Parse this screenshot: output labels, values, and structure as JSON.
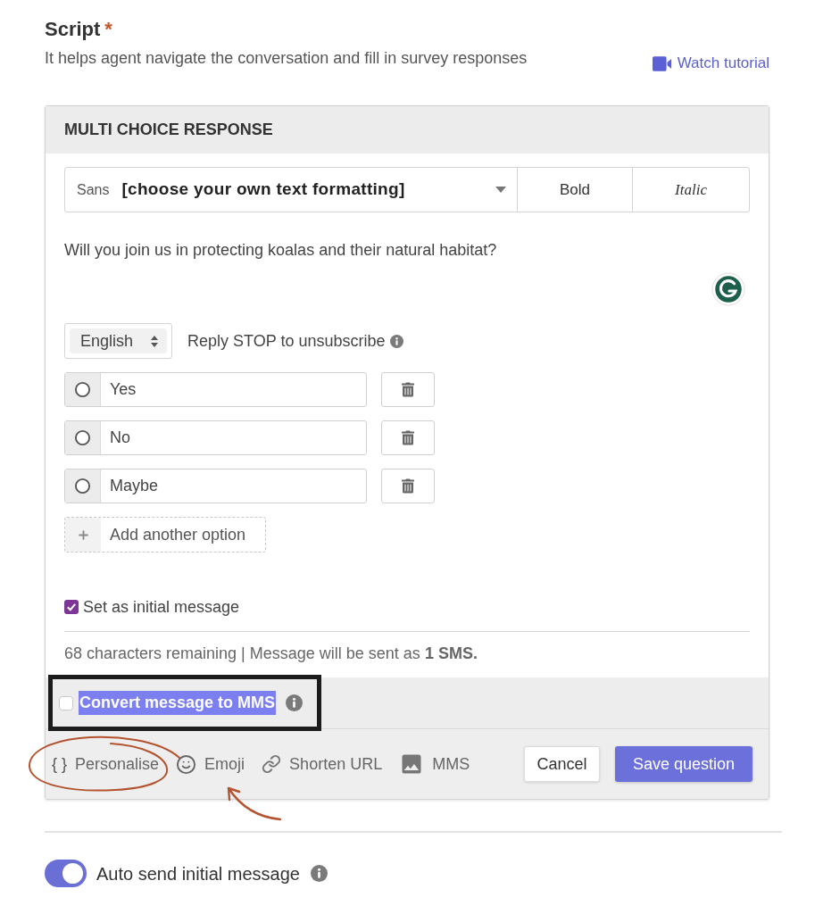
{
  "header": {
    "title": "Script",
    "required_mark": "*",
    "subtitle": "It helps agent navigate the conversation and fill in survey responses",
    "tutorial_link": "Watch tutorial"
  },
  "card": {
    "title": "MULTI CHOICE RESPONSE",
    "format_bar": {
      "font": "Sans",
      "style": "[choose your own text formatting]",
      "buttons": [
        {
          "label": "Bold",
          "kind": "bold"
        },
        {
          "label": "Italic",
          "kind": "italic"
        }
      ]
    },
    "message": "Will you join us in protecting koalas and their natural habitat?",
    "language": "English",
    "opt_out": "Reply STOP to unsubscribe",
    "options": [
      {
        "label": "Yes",
        "selected": false
      },
      {
        "label": "No",
        "selected": false
      },
      {
        "label": "Maybe",
        "selected": false
      }
    ],
    "add_option": "Add another option",
    "initial_message": {
      "label": "Set as initial message",
      "checked": true
    },
    "counter": "68 characters remaining | Message will be sent as **1 SMS.**",
    "mms": {
      "label": "Convert message to MMS",
      "checked": false,
      "text_selected": true
    },
    "tools": [
      {
        "kind": "braces",
        "glyph": "{ }",
        "label": "Personalise"
      },
      {
        "kind": "emoji",
        "label": "Emoji"
      },
      {
        "kind": "link",
        "label": "Shorten URL"
      },
      {
        "kind": "image",
        "label": "MMS"
      }
    ],
    "actions": [
      {
        "kind": "secondary",
        "label": "Cancel"
      },
      {
        "kind": "primary",
        "label": "Save question"
      }
    ]
  },
  "auto_send": {
    "label": "Auto send initial message",
    "on": true
  },
  "annotations": [
    {
      "kind": "frame"
    },
    {
      "kind": "circle"
    },
    {
      "kind": "arrow"
    }
  ]
}
